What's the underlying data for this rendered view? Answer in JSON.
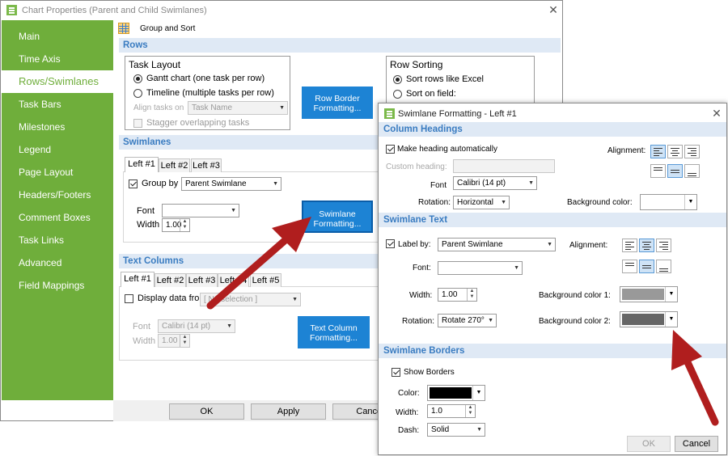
{
  "main": {
    "title": "Chart Properties (Parent and Child Swimlanes)",
    "group_sort": "Group and Sort",
    "sidebar": [
      "Main",
      "Time Axis",
      "Rows/Swimlanes",
      "Task Bars",
      "Milestones",
      "Legend",
      "Page Layout",
      "Headers/Footers",
      "Comment Boxes",
      "Task Links",
      "Advanced",
      "Field Mappings"
    ],
    "rows": {
      "header": "Rows",
      "task_layout": {
        "title": "Task Layout",
        "gantt": "Gantt chart (one task per row)",
        "timeline": "Timeline (multiple tasks per row)",
        "align_label": "Align tasks on",
        "align_value": "Task Name",
        "stagger": "Stagger overlapping tasks"
      },
      "row_border_btn": [
        "Row Border",
        "Formatting..."
      ],
      "row_sorting": {
        "title": "Row Sorting",
        "excel": "Sort rows like Excel",
        "field": "Sort on field:"
      }
    },
    "swimlanes": {
      "header": "Swimlanes",
      "tabs": [
        "Left #1",
        "Left #2",
        "Left #3"
      ],
      "group_by": "Group by",
      "group_value": "Parent Swimlane",
      "font_label": "Font",
      "width_label": "Width",
      "width_value": "1.00",
      "btn": [
        "Swimlane",
        "Formatting..."
      ]
    },
    "text_columns": {
      "header": "Text Columns",
      "tabs": [
        "Left #1",
        "Left #2",
        "Left #3",
        "Left #4",
        "Left #5"
      ],
      "display": "Display data from",
      "display_value": "[ No selection ]",
      "font_label": "Font",
      "font_value": "Calibri (14 pt)",
      "width_label": "Width",
      "width_value": "1.00",
      "btn": [
        "Text Column",
        "Formatting..."
      ]
    },
    "buttons": {
      "ok": "OK",
      "apply": "Apply",
      "cancel": "Cancel"
    }
  },
  "dialog": {
    "title": "Swimlane Formatting - Left #1",
    "col_headings": {
      "header": "Column Headings",
      "make_heading": "Make heading automatically",
      "custom_label": "Custom heading:",
      "font_label": "Font",
      "font_value": "Calibri (14 pt)",
      "rotation_label": "Rotation:",
      "rotation_value": "Horizontal",
      "alignment_label": "Alignment:",
      "bg_label": "Background color:"
    },
    "swimlane_text": {
      "header": "Swimlane Text",
      "label_by": "Label by:",
      "label_value": "Parent Swimlane",
      "font_label": "Font:",
      "width_label": "Width:",
      "width_value": "1.00",
      "rotation_label": "Rotation:",
      "rotation_value": "Rotate 270°",
      "alignment_label": "Alignment:",
      "bg1_label": "Background color 1:",
      "bg2_label": "Background color 2:"
    },
    "swimlane_borders": {
      "header": "Swimlane Borders",
      "show_borders": "Show Borders",
      "color_label": "Color:",
      "width_label": "Width:",
      "width_value": "1.0",
      "dash_label": "Dash:",
      "dash_value": "Solid"
    },
    "buttons": {
      "ok": "OK",
      "cancel": "Cancel"
    }
  },
  "colors": {
    "sidebar": "#6fae3b",
    "button_blue": "#1d83d4",
    "section_header": "#3a7cc1",
    "bg1": "#999999",
    "bg2": "#666666",
    "border_color": "#000000",
    "arrow": "#b01e1e"
  }
}
